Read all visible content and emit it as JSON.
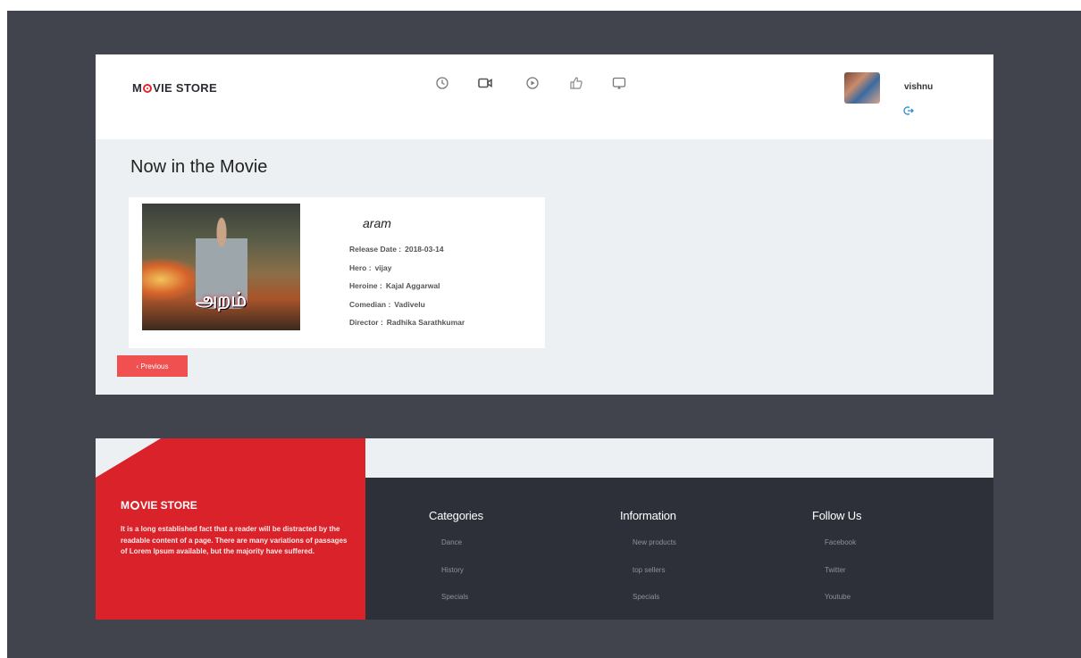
{
  "header": {
    "logo_prefix": "M",
    "logo_suffix": "VIE STORE",
    "nav_icons": [
      "clock-icon",
      "video-camera-icon",
      "play-circle-icon",
      "thumbs-up-icon",
      "screen-cast-icon"
    ],
    "user_name": "vishnu",
    "logout_icon": "logout-icon"
  },
  "main": {
    "title": "Now in the Movie",
    "movie": {
      "poster_title": "அறம்",
      "name": "aram",
      "details": [
        {
          "label": "Release Date :",
          "value": "2018-03-14"
        },
        {
          "label": "Hero :",
          "value": "vijay"
        },
        {
          "label": "Heroine :",
          "value": "Kajal Aggarwal"
        },
        {
          "label": "Comedian :",
          "value": "Vadivelu"
        },
        {
          "label": "Director :",
          "value": "Radhika Sarathkumar"
        }
      ]
    },
    "previous_label": "‹ Previous"
  },
  "footer": {
    "logo_prefix": "M",
    "logo_suffix": "VIE STORE",
    "description": "It is a long established fact that a reader will be distracted by the readable content of a page. There are many variations of passages of Lorem Ipsum available, but the majority have suffered.",
    "columns": [
      {
        "title": "Categories",
        "links": [
          "Dance",
          "History",
          "Specials"
        ]
      },
      {
        "title": "Information",
        "links": [
          "New products",
          "top sellers",
          "Specials"
        ]
      },
      {
        "title": "Follow Us",
        "links": [
          "Facebook",
          "Twitter",
          "Youtube"
        ]
      }
    ]
  },
  "colors": {
    "accent_red": "#d9222a",
    "button_red": "#f05050",
    "dark_bg": "#41444d",
    "footer_dark": "#2d3038"
  }
}
